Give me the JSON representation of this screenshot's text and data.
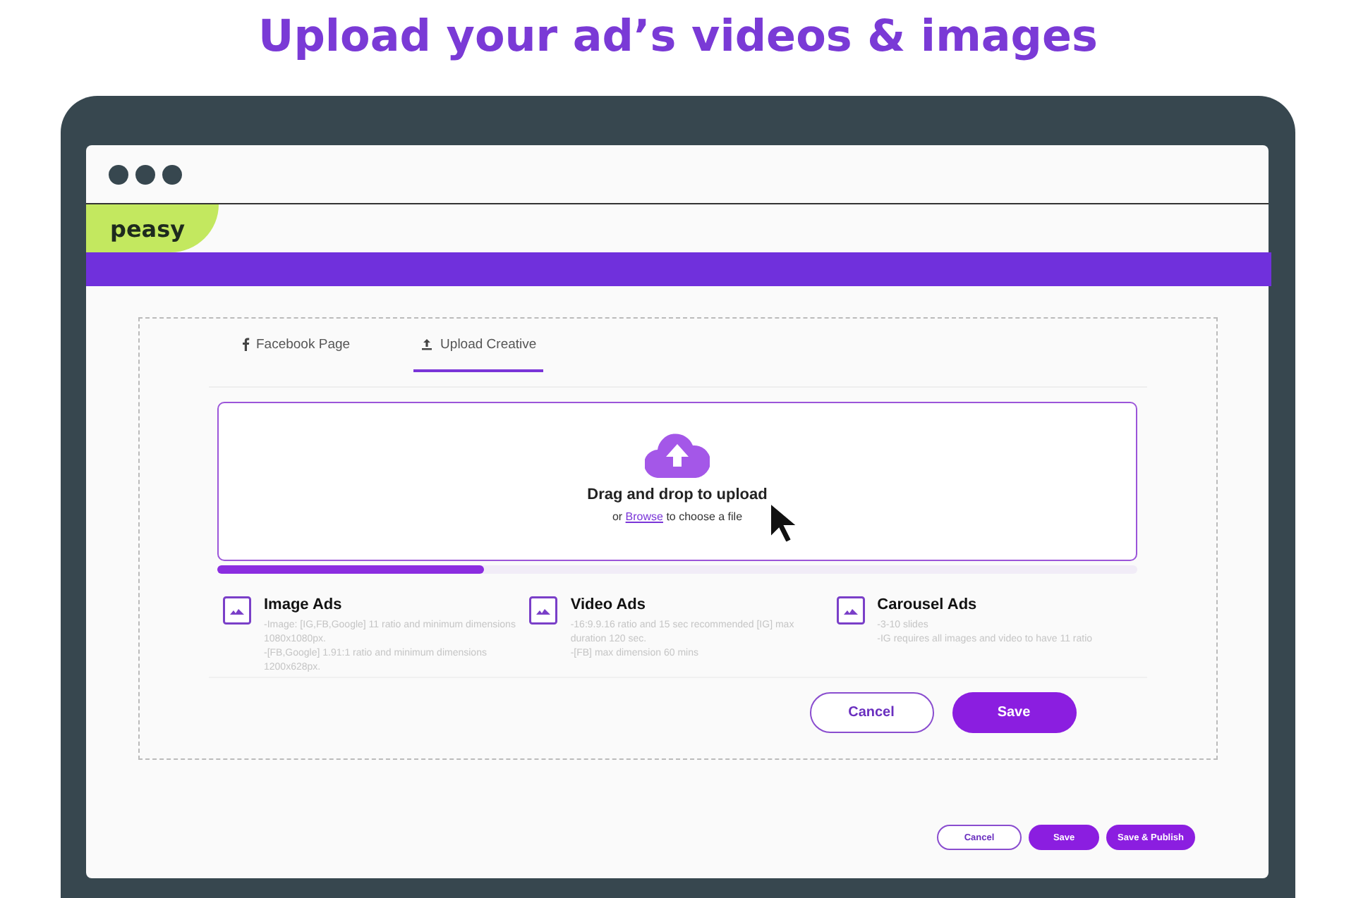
{
  "headline": "Upload your ad’s videos & images",
  "logo": "peasy",
  "tabs": [
    {
      "label": "Facebook Page",
      "kind": "facebook",
      "selected": false
    },
    {
      "label": "Upload Creative",
      "kind": "upload",
      "selected": true
    }
  ],
  "dropzone": {
    "title": "Drag and drop to upload",
    "link": "Browse",
    "link_after": "to choose a file",
    "link_before": "or"
  },
  "progress": {
    "level": 0.29
  },
  "ad_types": [
    {
      "title": "Image Ads",
      "lines": [
        "-Image: [IG,FB,Google] 11 ratio and minimum dimensions 1080x1080px.",
        "-[FB,Google] 1.91:1 ratio and minimum dimensions 1200x628px."
      ]
    },
    {
      "title": "Video Ads",
      "lines": [
        "-16:9.9.16 ratio and 15 sec recommended [IG] max duration 120 sec.",
        "-[FB] max dimension 60 mins"
      ]
    },
    {
      "title": "Carousel Ads",
      "lines": [
        "-3-10 slides",
        "-IG requires all images and video to have 11 ratio"
      ]
    }
  ],
  "dialog_buttons": [
    {
      "label": "Cancel",
      "kind": "outline"
    },
    {
      "label": "Save",
      "kind": "filled"
    }
  ],
  "footer_buttons": [
    {
      "label": "Cancel",
      "kind": "outline"
    },
    {
      "label": "Save",
      "kind": "filled"
    },
    {
      "label": "Save & Publish",
      "kind": "filled"
    }
  ]
}
